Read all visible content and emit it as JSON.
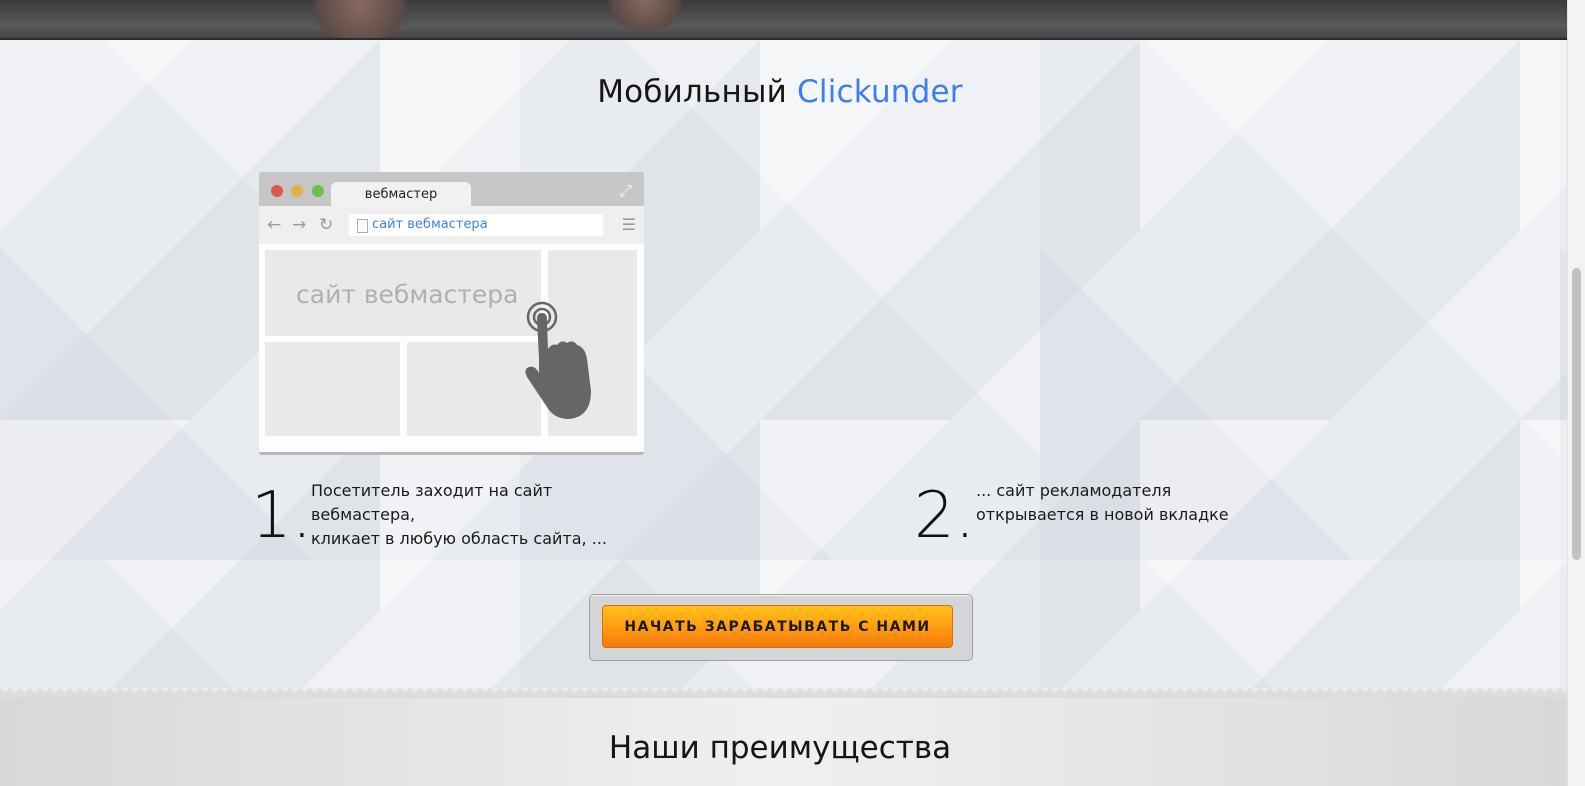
{
  "section": {
    "title_part1": "Мобильный",
    "title_part2": "Clickunder"
  },
  "browser": {
    "tab_label": "вебмастер",
    "url": "сайт вебмастера",
    "content_label": "сайт вебмастера"
  },
  "steps": [
    {
      "number": "1.",
      "text_lines": [
        "Посетитель заходит на сайт",
        "вебмастера,",
        "кликает в любую область сайта, ..."
      ]
    },
    {
      "number": "2.",
      "text_lines": [
        "... сайт рекламодателя",
        "открывается в новой вкладке"
      ]
    }
  ],
  "cta": {
    "label": "НАЧАТЬ ЗАРАБАТЫВАТЬ С НАМИ"
  },
  "advantages": {
    "title": "Наши преимущества"
  },
  "colors": {
    "accent": "#3d7ff0",
    "button": "#ff9a12"
  }
}
